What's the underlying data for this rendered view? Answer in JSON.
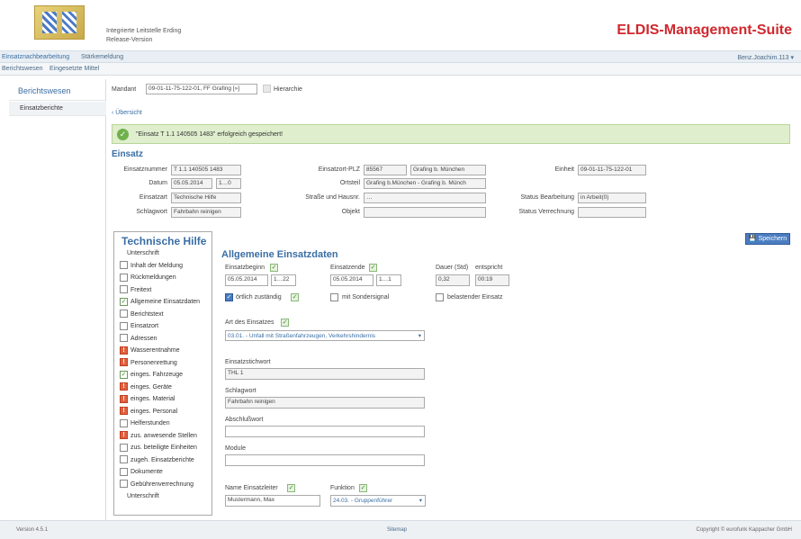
{
  "header": {
    "org_line1": "Integrierte Leitstelle Erding",
    "org_line2": "Release-Version",
    "app_title": "ELDIS-Management-Suite",
    "user": "Benz.Joachim.113 ▾"
  },
  "nav1": [
    "Einsatznachbearbeitung",
    "Stärkemeldung"
  ],
  "nav2": [
    "Berichtswesen",
    "Eingesetzte Mittel"
  ],
  "sidebar": {
    "title": "Berichtswesen",
    "items": [
      "Einsatzberichte"
    ]
  },
  "mandant": {
    "label": "Mandant",
    "value": "09-01-11-75-122-01, FF Grafing [»]",
    "hierarchie_label": "Hierarchie"
  },
  "back_link": "‹ Übersicht",
  "success_message": "\"Einsatz T 1.1 140505 1483\" erfolgreich gespeichert!",
  "einsatz": {
    "title": "Einsatz",
    "einsatznummer_label": "Einsatznummer",
    "einsatznummer": "T 1.1 140505 1483",
    "datum_label": "Datum",
    "datum": "05.05.2014",
    "datum_time": "1…0",
    "einsatzart_label": "Einsatzart",
    "einsatzart": "Technische Hilfe",
    "schlagwort_label": "Schlagwort",
    "schlagwort": "Fahrbahn reinigen",
    "plz_label": "Einsatzort-PLZ",
    "plz": "85567",
    "ort": "Grafing b. München",
    "ortsteil_label": "Ortsteil",
    "ortsteil": "Grafing b.München - Grafing b. Münch",
    "strasse_label": "Straße und Hausnr.",
    "strasse": "…",
    "objekt_label": "Objekt",
    "objekt": "",
    "einheit_label": "Einheit",
    "einheit": "09-01-11-75-122-01 ",
    "status_bearbeitung_label": "Status Bearbeitung",
    "status_bearbeitung": "in Arbeit(0)",
    "status_verrechnung_label": "Status Verrechnung",
    "status_verrechnung": ""
  },
  "panel": {
    "title": "Technische Hilfe",
    "items": [
      {
        "label": "Unterschrift",
        "state": "none"
      },
      {
        "label": "Inhalt der Meldung",
        "state": "empty"
      },
      {
        "label": "Rückmeldungen",
        "state": "empty"
      },
      {
        "label": "Freitext",
        "state": "empty"
      },
      {
        "label": "Allgemeine Einsatzdaten",
        "state": "ok"
      },
      {
        "label": "Berichtstext",
        "state": "empty"
      },
      {
        "label": "Einsatzort",
        "state": "empty"
      },
      {
        "label": "Adressen",
        "state": "empty"
      },
      {
        "label": "Wasserentnahme",
        "state": "warn"
      },
      {
        "label": "Personenrettung",
        "state": "warn"
      },
      {
        "label": "einges. Fahrzeuge",
        "state": "ok"
      },
      {
        "label": "einges. Geräte",
        "state": "warn"
      },
      {
        "label": "einges. Material",
        "state": "warn"
      },
      {
        "label": "einges. Personal",
        "state": "warn"
      },
      {
        "label": "Helferstunden",
        "state": "empty"
      },
      {
        "label": "zus. anwesende Stellen",
        "state": "warn"
      },
      {
        "label": "zus. beteiligte Einheiten",
        "state": "empty"
      },
      {
        "label": "zugeh. Einsatzberichte",
        "state": "empty"
      },
      {
        "label": "Dokumente",
        "state": "empty"
      },
      {
        "label": "Gebührenverrechnung",
        "state": "empty"
      },
      {
        "label": "Unterschrift",
        "state": "none"
      }
    ]
  },
  "save_label": "Speichern",
  "allg": {
    "title": "Allgemeine Einsatzdaten",
    "beginn_label": "Einsatzbeginn",
    "beginn_date": "05.05.2014",
    "beginn_time": "1…22",
    "ende_label": "Einsatzende",
    "ende_date": "05.05.2014",
    "ende_time": "1…1",
    "dauer_label": "Dauer (Std)",
    "dauer": "0,32",
    "entspricht_label": "entspricht",
    "entspricht": "00:19",
    "oertlich_label": "örtlich zuständig",
    "sondersignal_label": "mit Sondersignal",
    "belastend_label": "belastender Einsatz",
    "art_label": "Art des Einsatzes",
    "art_value": "03.01. - Unfall mit Straßenfahrzeugen, Verkehrshindernis",
    "stichwort_label": "Einsatzstichwort",
    "stichwort": "THL 1",
    "schlagwort_label": "Schlagwort",
    "schlagwort": "Fahrbahn reinigen",
    "abschluss_label": "Abschlußwort",
    "abschluss": "",
    "module_label": "Module",
    "module": "",
    "leiter_label": "Name Einsatzleiter",
    "leiter": "Mustermann, Max",
    "funktion_label": "Funktion",
    "funktion": "24.03. - Gruppenführer"
  },
  "footer": {
    "version": "Version 4.5.1",
    "sitemap": "Sitemap",
    "copyright": "Copyright © eurofunk Kappacher GmbH"
  }
}
